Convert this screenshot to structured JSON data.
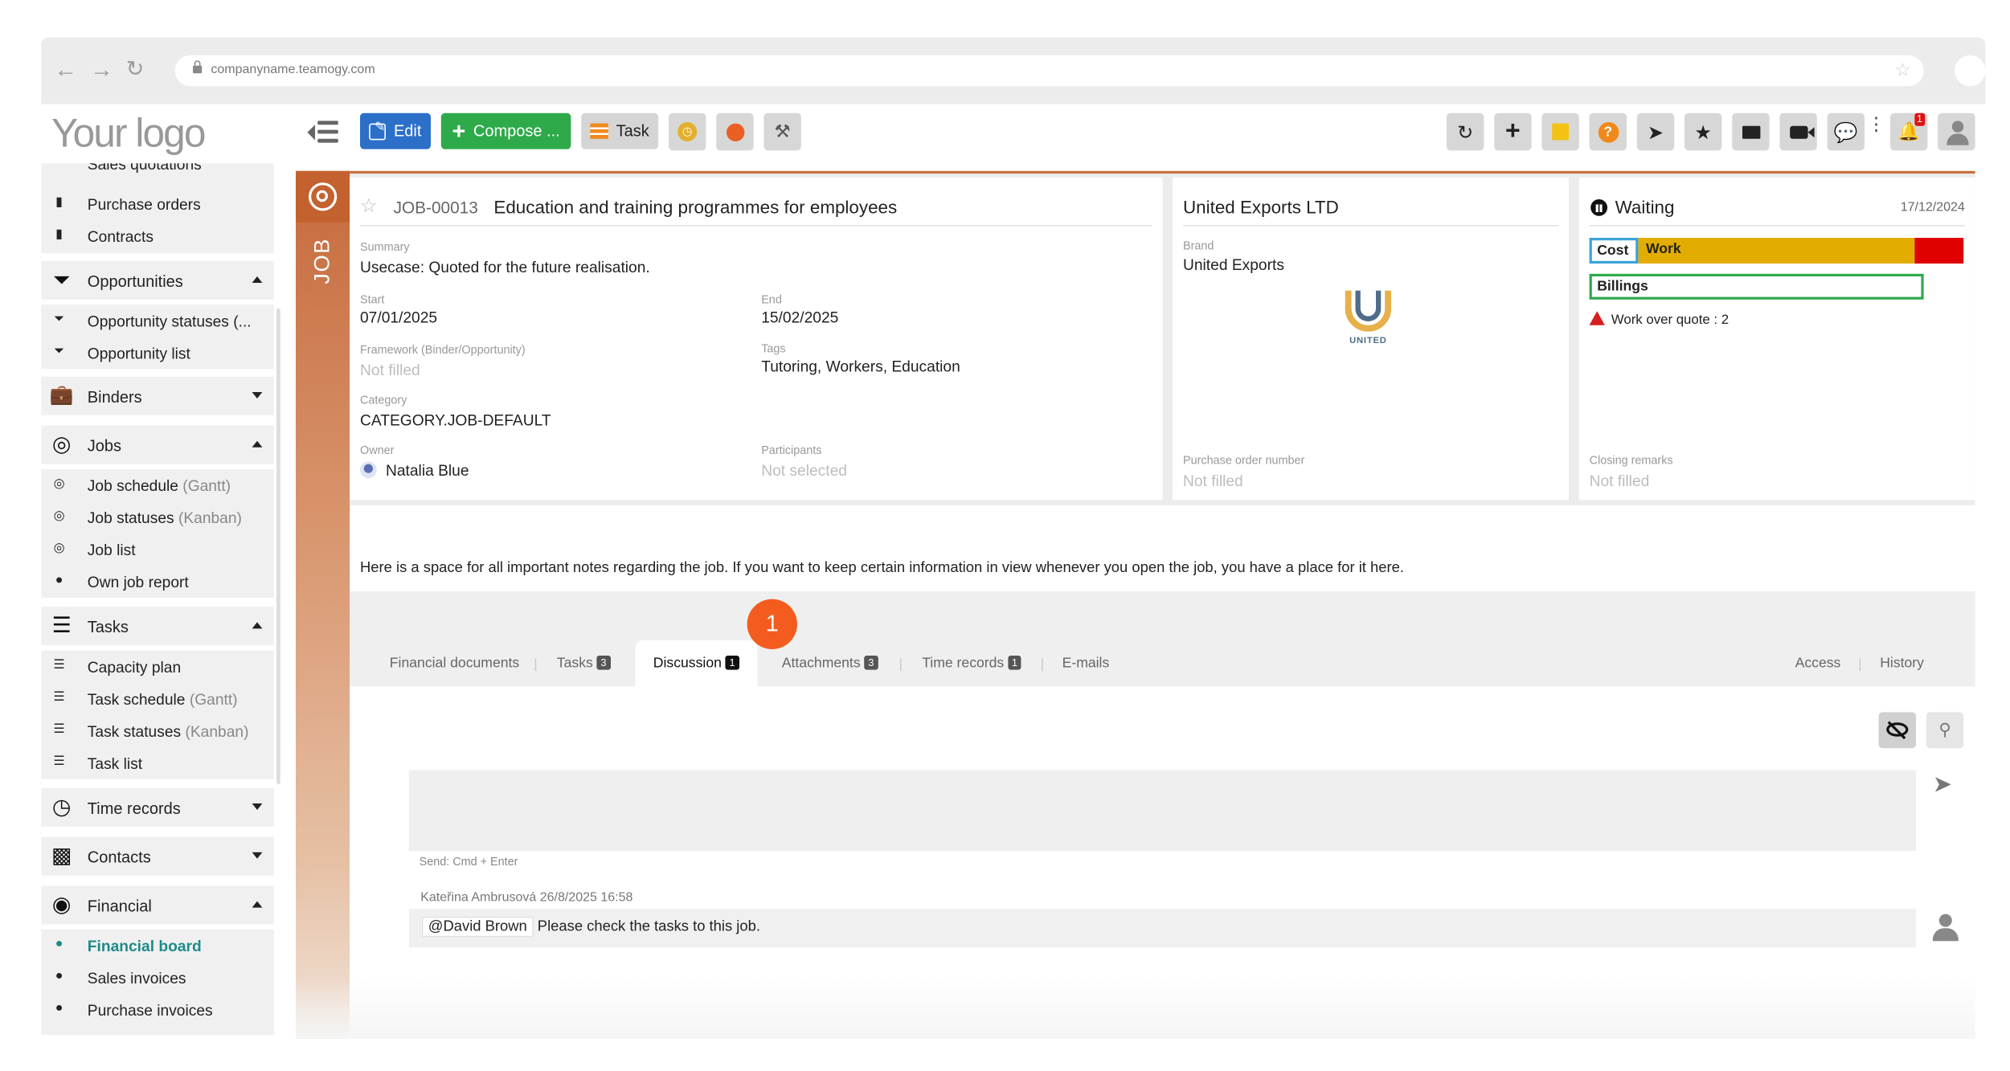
{
  "browser": {
    "url": "companyname.teamogy.com"
  },
  "logo": "Your logo",
  "toolbar": {
    "edit_label": "Edit",
    "compose_label": "Compose ...",
    "task_label": "Task",
    "notification_count": "1",
    "colors": {
      "edit": "#2c6fc9",
      "compose": "#2eaa4a",
      "task": "#d5d5d5",
      "yellow": "#e2b02c",
      "orange": "#ea5f24"
    }
  },
  "sidebar": {
    "cut_top": "Sales quotations",
    "items_top": [
      "Purchase orders",
      "Contracts"
    ],
    "opportunities": {
      "label": "Opportunities",
      "items": [
        "Opportunity statuses (...",
        "Opportunity list"
      ]
    },
    "binders": {
      "label": "Binders"
    },
    "jobs": {
      "label": "Jobs",
      "items": [
        {
          "label": "Job schedule",
          "suffix": "(Gantt)"
        },
        {
          "label": "Job statuses",
          "suffix": "(Kanban)"
        },
        {
          "label": "Job list",
          "suffix": ""
        },
        {
          "label": "Own job report",
          "suffix": ""
        }
      ]
    },
    "tasks": {
      "label": "Tasks",
      "items": [
        {
          "label": "Capacity plan",
          "suffix": ""
        },
        {
          "label": "Task schedule",
          "suffix": "(Gantt)"
        },
        {
          "label": "Task statuses",
          "suffix": "(Kanban)"
        },
        {
          "label": "Task list",
          "suffix": ""
        }
      ]
    },
    "time_records": {
      "label": "Time records"
    },
    "contacts": {
      "label": "Contacts"
    },
    "financial": {
      "label": "Financial",
      "items": [
        "Financial board",
        "Sales invoices",
        "Purchase invoices"
      ],
      "active_color": "#1f8a8a"
    }
  },
  "job": {
    "strip_label": "JOB",
    "id": "JOB-00013",
    "title": "Education and training programmes for employees",
    "summary_label": "Summary",
    "summary": "Usecase: Quoted for the future realisation.",
    "start_label": "Start",
    "start": "07/01/2025",
    "end_label": "End",
    "end": "15/02/2025",
    "framework_label": "Framework (Binder/Opportunity)",
    "framework": "Not filled",
    "tags_label": "Tags",
    "tags": "Tutoring, Workers, Education",
    "category_label": "Category",
    "category": "CATEGORY.JOB-DEFAULT",
    "owner_label": "Owner",
    "owner": "Natalia Blue",
    "participants_label": "Participants",
    "participants": "Not selected"
  },
  "client": {
    "name": "United Exports LTD",
    "brand_label": "Brand",
    "brand": "United Exports",
    "logo_text": "UNITED",
    "po_label": "Purchase order number",
    "po": "Not filled"
  },
  "status": {
    "label": "Waiting",
    "date": "17/12/2024",
    "cost_label": "Cost",
    "work_label": "Work",
    "billings_label": "Billings",
    "warning": "Work over quote : 2",
    "work_fill_fraction": 0.87,
    "closing_label": "Closing remarks",
    "closing": "Not filled",
    "colors": {
      "work": "#e2ad00",
      "over": "#e00000",
      "cost_border": "#3aa3d8",
      "billing_border": "#2fa84f"
    }
  },
  "notes": "Here is a space for all important notes regarding the job. If you want to keep certain information in view whenever you open the job, you have a place for it here.",
  "tabs": [
    {
      "label": "Financial documents",
      "badge": ""
    },
    {
      "label": "Tasks",
      "badge": "3"
    },
    {
      "label": "Discussion",
      "badge": "1"
    },
    {
      "label": "Attachments",
      "badge": "3"
    },
    {
      "label": "Time records",
      "badge": "1"
    },
    {
      "label": "E-mails",
      "badge": ""
    }
  ],
  "tabs_right": [
    "Access",
    "History"
  ],
  "callout_number": "1",
  "discussion": {
    "send_hint": "Send: Cmd + Enter",
    "message": {
      "author_line": "Kateřina Ambrusová 26/8/2025 16:58",
      "mention": "@David Brown",
      "text": "Please check the tasks to this job."
    }
  }
}
